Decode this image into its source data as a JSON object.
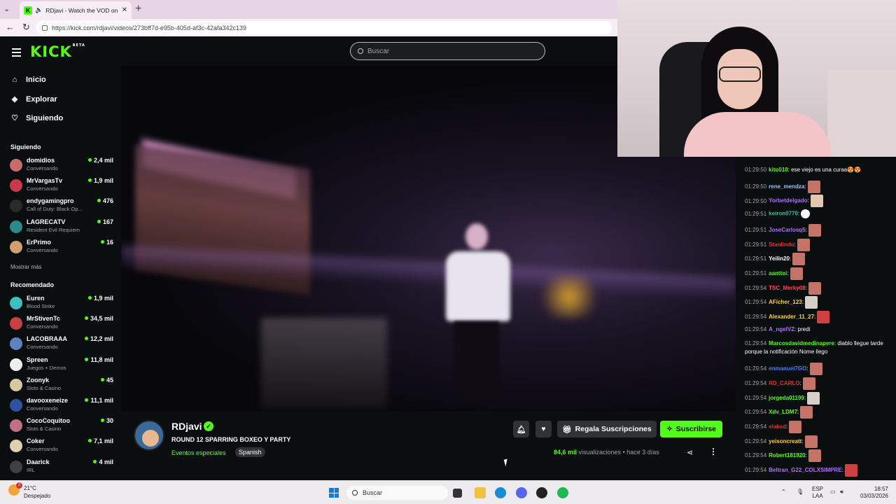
{
  "browser": {
    "tab_title": "RDjavi - Watch the VOD on Ki",
    "url": "https://kick.com/rdjavi/videos/273bff7d-e95b-405d-af3c-42afa342c139"
  },
  "header": {
    "logo": "KICK",
    "logo_badge": "BETA",
    "search_placeholder": "Buscar"
  },
  "sidebar": {
    "nav": [
      {
        "label": "Inicio",
        "icon": "home-icon"
      },
      {
        "label": "Explorar",
        "icon": "compass-icon"
      },
      {
        "label": "Siguiendo",
        "icon": "heart-icon"
      }
    ],
    "following_title": "Siguiendo",
    "following": [
      {
        "name": "domidios",
        "sub": "Conversando",
        "count": "2,4 mil",
        "color": "#c96b6b"
      },
      {
        "name": "MrVargasTv",
        "sub": "Conversando",
        "count": "1,9 mil",
        "color": "#c83a4a"
      },
      {
        "name": "endygamingpro",
        "sub": "Call of Duty: Black Op...",
        "count": "476",
        "color": "#2a2a2a"
      },
      {
        "name": "LAGRECATV",
        "sub": "Resident Evil Requiem",
        "count": "167",
        "color": "#2b8a8a"
      },
      {
        "name": "ErPrimo",
        "sub": "Conversando",
        "count": "16",
        "color": "#d0a070"
      }
    ],
    "show_more": "Mostrar más",
    "recommended_title": "Recomendado",
    "recommended": [
      {
        "name": "Euren",
        "sub": "Blood Strike",
        "count": "1,9 mil",
        "color": "#3ac0c0"
      },
      {
        "name": "MrStivenTc",
        "sub": "Conversando",
        "count": "34,5 mil",
        "color": "#c84040"
      },
      {
        "name": "LACOBRAAA",
        "sub": "Conversando",
        "count": "12,2 mil",
        "color": "#6080c0"
      },
      {
        "name": "Spreen",
        "sub": "Juegos + Demos",
        "count": "11,8 mil",
        "color": "#eeeeee"
      },
      {
        "name": "Zoonyk",
        "sub": "Slots & Casino",
        "count": "45",
        "color": "#d8c8a0"
      },
      {
        "name": "davooxeneize",
        "sub": "Conversando",
        "count": "11,1 mil",
        "color": "#3050a0"
      },
      {
        "name": "CocoCoquitoo",
        "sub": "Slots & Casino",
        "count": "30",
        "color": "#c07080"
      },
      {
        "name": "Coker",
        "sub": "Conversando",
        "count": "7,1 mil",
        "color": "#e0d0b0"
      },
      {
        "name": "Daarick",
        "sub": "IRL",
        "count": "4 mil",
        "color": "#404040"
      }
    ]
  },
  "chat": {
    "messages": [
      {
        "ts": "01:29:50",
        "user": "kito010",
        "color": "#53fc18",
        "text": " ese viejo es una curaa😍😍",
        "emote": ""
      },
      {
        "ts": "01:29:50",
        "user": "rene_mendza",
        "color": "#a0c0ff",
        "text": "",
        "emote": "normal"
      },
      {
        "ts": "01:29:50",
        "user": "Yorbetdelgado",
        "color": "#b070ff",
        "text": "",
        "emote": "pale"
      },
      {
        "ts": "01:29:51",
        "user": "keiron0770",
        "color": "#30c0a0",
        "text": "",
        "emote": "ghost"
      },
      {
        "ts": "01:29:51",
        "user": "JoseCarlosq5",
        "color": "#b070ff",
        "text": "",
        "emote": "normal"
      },
      {
        "ts": "01:29:51",
        "user": "Stanlindo",
        "color": "#e03030",
        "text": "",
        "emote": "normal"
      },
      {
        "ts": "01:29:51",
        "user": "Yeilin20",
        "color": "#ffffff",
        "text": "",
        "emote": "normal"
      },
      {
        "ts": "01:29:51",
        "user": "aanttoi",
        "color": "#53fc18",
        "text": "",
        "emote": "normal"
      },
      {
        "ts": "01:29:54",
        "user": "TSC_Merky08",
        "color": "#ff4060",
        "text": "",
        "emote": "normal"
      },
      {
        "ts": "01:29:54",
        "user": "AFicher_123",
        "color": "#ffd040",
        "text": "",
        "emote": "cat"
      },
      {
        "ts": "01:29:54",
        "user": "Alexander_11_27",
        "color": "#ffd040",
        "text": "",
        "emote": "red"
      },
      {
        "ts": "01:29:54",
        "user": "A_ngelVZ",
        "color": "#b070ff",
        "text": " predi",
        "emote": ""
      },
      {
        "ts": "01:29:54",
        "user": "Marcosdavidmedinapere",
        "color": "#53fc18",
        "text": " diablo llegue tarde porque la notificación Nome llego",
        "emote": ""
      },
      {
        "ts": "01:29:54",
        "user": "enmanuel7GO",
        "color": "#4080ff",
        "text": "",
        "emote": "normal"
      },
      {
        "ts": "01:29:54",
        "user": "RD_CARLO",
        "color": "#e03030",
        "text": "",
        "emote": "normal"
      },
      {
        "ts": "01:29:54",
        "user": "jorgeda01199",
        "color": "#53fc18",
        "text": "",
        "emote": "cat"
      },
      {
        "ts": "01:29:54",
        "user": "Xdv_LDM7",
        "color": "#53fc18",
        "text": "",
        "emote": "normal"
      },
      {
        "ts": "01:29:54",
        "user": "elaksd",
        "color": "#e03030",
        "text": "",
        "emote": "normal"
      },
      {
        "ts": "01:29:54",
        "user": "yeisoncreatt",
        "color": "#ffd040",
        "text": "",
        "emote": "normal"
      },
      {
        "ts": "01:29:54",
        "user": "Robert181920",
        "color": "#53fc18",
        "text": "",
        "emote": "normal"
      },
      {
        "ts": "01:29:54",
        "user": "Beltran_G22_COLXSIMPRE",
        "color": "#b070ff",
        "text": "",
        "emote": "red"
      }
    ]
  },
  "stream": {
    "streamer": "RDjavi",
    "title": "ROUND 12 SPARRING  BOXEO Y PARTY",
    "category": "Eventos especiales",
    "language": "Spanish",
    "gift_label": "Regala Suscripciones",
    "subscribe_label": "Suscribirse",
    "views_count": "84,6 mil",
    "views_label": " visualizaciones",
    "separator": " • ",
    "age": "hace 3 días"
  },
  "taskbar": {
    "temp": "21°C",
    "weather": "Despejado",
    "weather_badge": "2",
    "search": "Buscar",
    "lang_top": "ESP",
    "lang_bottom": "LAA",
    "time": "18:57",
    "date": "03/03/2026"
  },
  "colors": {
    "accent": "#53fc18",
    "bg": "#0b0e0f"
  }
}
